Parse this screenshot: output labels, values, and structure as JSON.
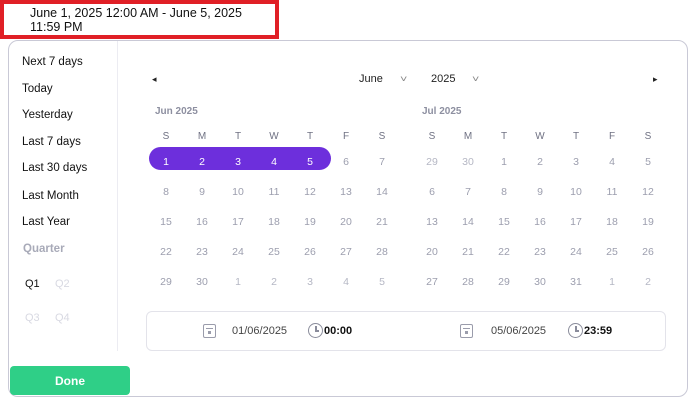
{
  "range_input": {
    "value": "June 1, 2025 12:00 AM - June 5, 2025 11:59 PM"
  },
  "presets": {
    "next7": "Next 7 days",
    "today": "Today",
    "yesterday": "Yesterday",
    "last7": "Last 7 days",
    "last30": "Last 30 days",
    "last_month": "Last Month",
    "last_year": "Last Year"
  },
  "quarter": {
    "heading": "Quarter",
    "q1": "Q1",
    "q2": "Q2",
    "q3": "Q3",
    "q4": "Q4"
  },
  "nav": {
    "month": "June",
    "year": "2025",
    "prev_icon": "◂",
    "next_icon": "▸",
    "chevron": "˅"
  },
  "weekdays": [
    "S",
    "M",
    "T",
    "W",
    "T",
    "F",
    "S"
  ],
  "left_month": {
    "title": "Jun 2025",
    "weeks": [
      [
        "1",
        "2",
        "3",
        "4",
        "5",
        "6",
        "7"
      ],
      [
        "8",
        "9",
        "10",
        "11",
        "12",
        "13",
        "14"
      ],
      [
        "15",
        "16",
        "17",
        "18",
        "19",
        "20",
        "21"
      ],
      [
        "22",
        "23",
        "24",
        "25",
        "26",
        "27",
        "28"
      ],
      [
        "29",
        "30",
        "1",
        "2",
        "3",
        "4",
        "5"
      ]
    ]
  },
  "right_month": {
    "title": "Jul 2025",
    "weeks": [
      [
        "29",
        "30",
        "1",
        "2",
        "3",
        "4",
        "5"
      ],
      [
        "6",
        "7",
        "8",
        "9",
        "10",
        "11",
        "12"
      ],
      [
        "13",
        "14",
        "15",
        "16",
        "17",
        "18",
        "19"
      ],
      [
        "20",
        "21",
        "22",
        "23",
        "24",
        "25",
        "26"
      ],
      [
        "27",
        "28",
        "29",
        "30",
        "31",
        "1",
        "2"
      ]
    ]
  },
  "time_bar": {
    "start_date": "01/06/2025",
    "start_time": "00:00",
    "end_date": "05/06/2025",
    "end_time": "23:59"
  },
  "done_label": "Done",
  "colors": {
    "accent": "#6d2fdc",
    "done": "#2fcf87",
    "highlight_border": "#e01f26"
  }
}
